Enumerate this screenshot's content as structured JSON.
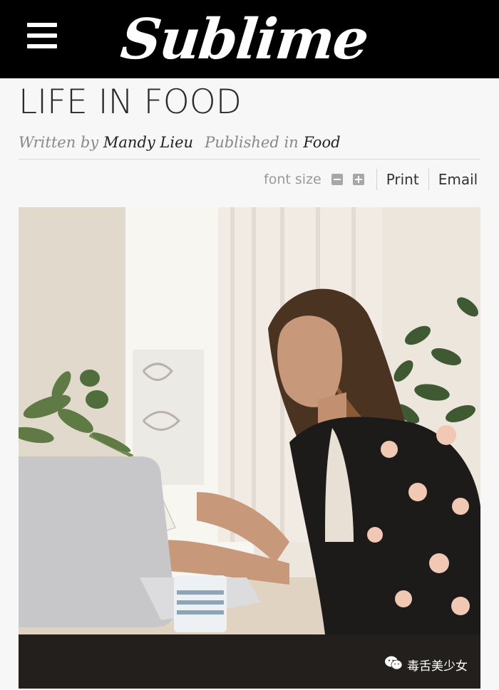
{
  "header": {
    "menu_icon": "hamburger-menu-icon",
    "logo_text": "Sublime",
    "background": "#000000"
  },
  "article": {
    "title": "LIFE IN FOOD",
    "written_by_label": "Written by",
    "author": "Mandy Lieu",
    "published_in_label": "Published in",
    "category": "Food"
  },
  "tools": {
    "font_size_label": "font size",
    "decrease_icon": "minus-square-icon",
    "increase_icon": "plus-square-icon",
    "print_label": "Print",
    "email_label": "Email"
  },
  "image": {
    "description_icon": "photo-woman-laptop"
  },
  "watermark": {
    "text": "毒舌美少女",
    "icon": "wechat-icon"
  }
}
